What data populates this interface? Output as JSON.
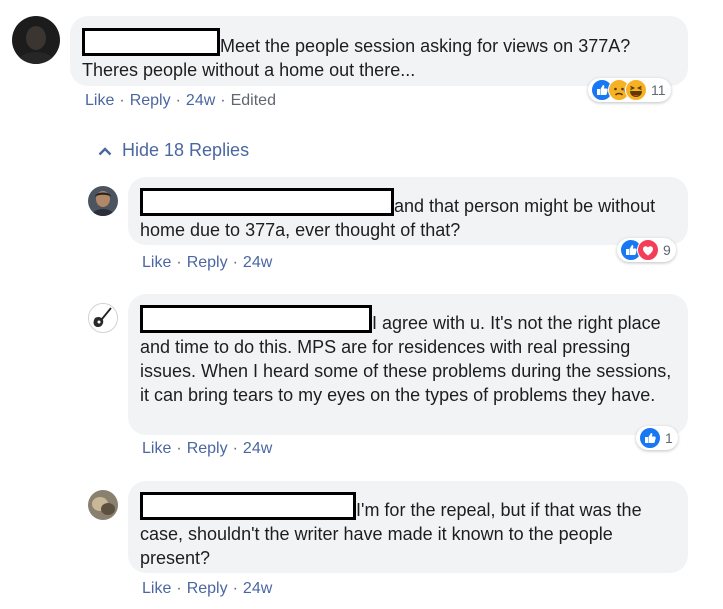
{
  "comment": {
    "text": "Meet the people session asking for views on 377A? Theres people without a home out there...",
    "reaction_icons": [
      "like-icon",
      "sad-icon",
      "haha-icon"
    ],
    "reaction_count": "11",
    "like": "Like",
    "reply": "Reply",
    "time": "24w",
    "edited": "Edited"
  },
  "hide_replies": "Hide 18 Replies",
  "replies": [
    {
      "text": "and that person might be without home due to 377a, ever thought of that?",
      "reaction_icons": [
        "like-icon",
        "love-icon"
      ],
      "reaction_count": "9",
      "like": "Like",
      "reply": "Reply",
      "time": "24w"
    },
    {
      "text": "I agree with u. It's not the right place and time to do this. MPS are for residences with real pressing issues. When I heard some of these problems during the sessions, it can bring tears to my eyes on the types of problems they have.",
      "reaction_icons": [
        "like-icon"
      ],
      "reaction_count": "1",
      "like": "Like",
      "reply": "Reply",
      "time": "24w"
    },
    {
      "text": "I'm for the repeal, but if that was the case, shouldn't the writer have made it known to the people present?",
      "like": "Like",
      "reply": "Reply",
      "time": "24w"
    }
  ],
  "colors": {
    "link": "#4b67a1",
    "bubble": "#f2f3f5",
    "like": "#1877f2",
    "love": "#f33e58",
    "emoji": "#f7b125"
  }
}
